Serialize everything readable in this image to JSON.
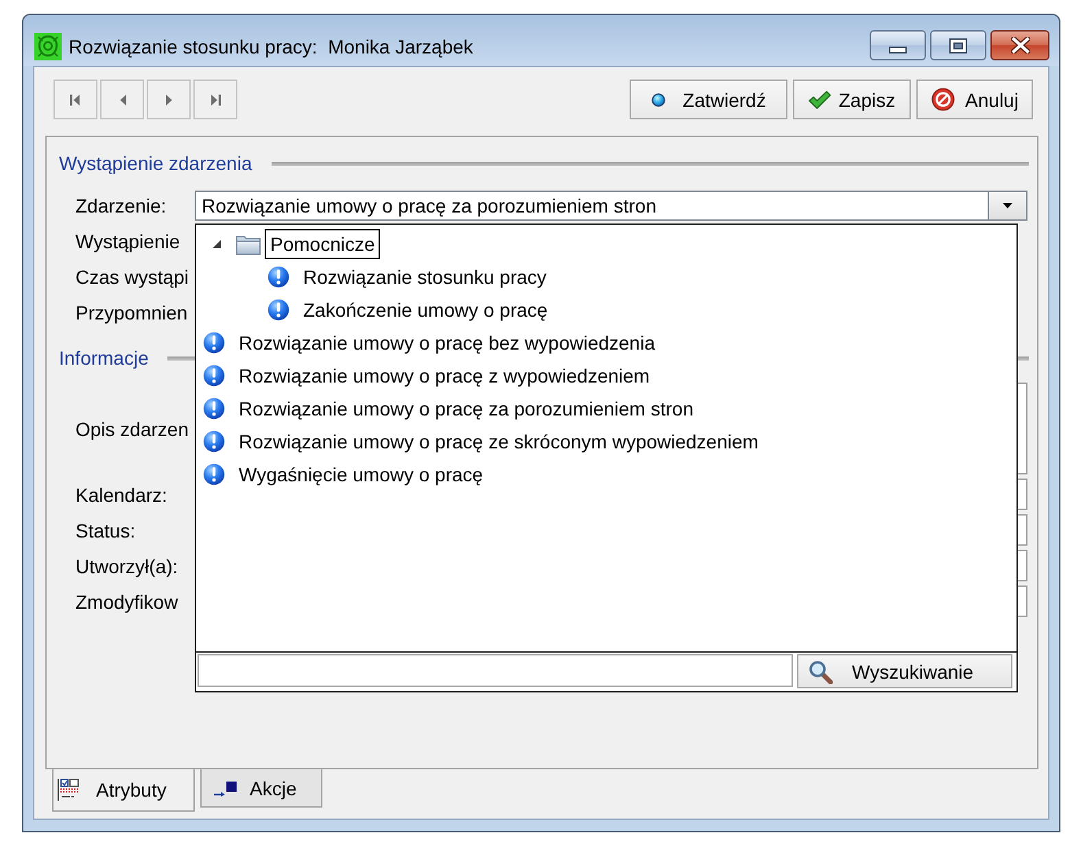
{
  "window": {
    "title": "Rozwiązanie stosunku pracy:  Monika Jarząbek"
  },
  "toolbar": {
    "actions": [
      {
        "label": "Zatwierdź",
        "kind": "confirm"
      },
      {
        "label": "Zapisz",
        "kind": "save"
      },
      {
        "label": "Anuluj",
        "kind": "cancel"
      }
    ]
  },
  "form": {
    "sections": [
      {
        "title": "Wystąpienie zdarzenia",
        "fields": [
          {
            "label": "Zdarzenie:",
            "kind": "combo",
            "value": "Rozwiązanie umowy o pracę za porozumieniem stron"
          },
          {
            "label": "Wystąpienie",
            "kind": "label_only"
          },
          {
            "label": "Czas wystąpi",
            "kind": "label_only"
          },
          {
            "label": "Przypomnien",
            "kind": "label_only"
          }
        ]
      },
      {
        "title": "Informacje",
        "fields": [
          {
            "label": "Opis zdarzen",
            "kind": "memo"
          },
          {
            "label": "Kalendarz:",
            "kind": "text"
          },
          {
            "label": "Status:",
            "kind": "text"
          },
          {
            "label": "Utworzył(a):",
            "kind": "text"
          },
          {
            "label": "Zmodyfikow",
            "kind": "text"
          }
        ]
      }
    ]
  },
  "dropdown": {
    "open": true,
    "tree": [
      {
        "label": "Pomocnicze",
        "kind": "folder",
        "expanded": true,
        "selected": true,
        "children": [
          {
            "label": "Rozwiązanie stosunku pracy",
            "kind": "event",
            "selected": false
          },
          {
            "label": "Zakończenie umowy o pracę",
            "kind": "event",
            "selected": false
          }
        ]
      },
      {
        "label": "Rozwiązanie umowy o pracę bez wypowiedzenia",
        "kind": "event",
        "selected": false
      },
      {
        "label": "Rozwiązanie umowy o pracę z wypowiedzeniem",
        "kind": "event",
        "selected": false
      },
      {
        "label": "Rozwiązanie umowy o pracę za porozumieniem stron",
        "kind": "event",
        "selected": false
      },
      {
        "label": "Rozwiązanie umowy o pracę ze skróconym wypowiedzeniem",
        "kind": "event",
        "selected": false
      },
      {
        "label": "Wygaśnięcie umowy o pracę",
        "kind": "event",
        "selected": false
      }
    ],
    "search_button": "Wyszukiwanie"
  },
  "tabs": [
    {
      "label": "Atrybuty",
      "kind": "attributes",
      "selected": true
    },
    {
      "label": "Akcje",
      "kind": "actions",
      "selected": false
    }
  ]
}
